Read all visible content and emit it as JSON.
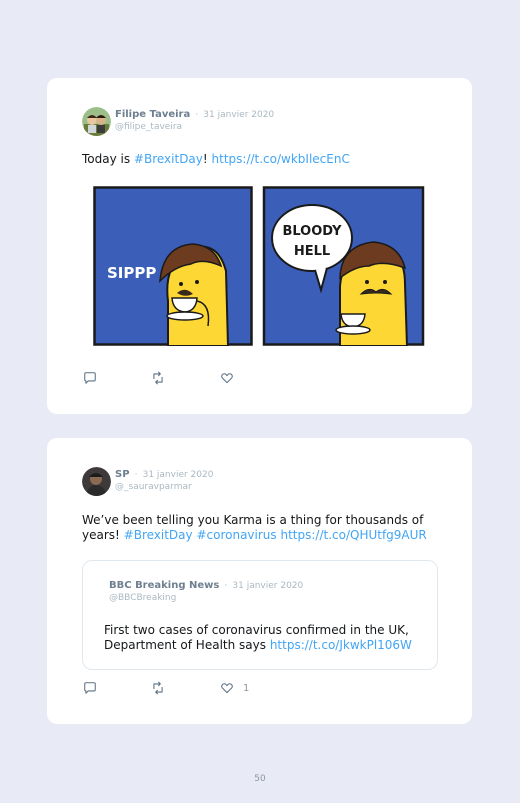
{
  "tweets": [
    {
      "user": {
        "name": "Filipe Taveira",
        "handle": "@filipe_taveira"
      },
      "separator": "·",
      "date": "31 janvier 2020",
      "text_parts": [
        "Today is ",
        "#BrexitDay",
        "! ",
        "https://t.co/wkbIlecEnC"
      ],
      "comic": {
        "left_text": "SIPPP",
        "speech_line1": "BLOODY",
        "speech_line2": "HELL"
      },
      "actions": {
        "reply_icon": "reply-icon",
        "retweet_icon": "retweet-icon",
        "like_icon": "heart-icon"
      }
    },
    {
      "user": {
        "name": "SP",
        "handle": "@_sauravparmar"
      },
      "separator": "·",
      "date": "31 janvier 2020",
      "text_line1": "We’ve been telling you Karma is a thing for thousands of",
      "text_parts": [
        "years! ",
        "#BrexitDay",
        " ",
        "#coronavirus",
        " ",
        "https://t.co/QHUtfg9AUR"
      ],
      "quoted": {
        "user": {
          "name": "BBC Breaking News",
          "handle": "@BBCBreaking"
        },
        "separator": "·",
        "date": "31 janvier 2020",
        "text_line1": "First two cases of coronavirus confirmed in the UK,",
        "text_line2_prefix": "Department of Health says ",
        "link": "https://t.co/JkwkPl106W"
      },
      "actions": {
        "reply_icon": "reply-icon",
        "retweet_icon": "retweet-icon",
        "like_icon": "heart-icon",
        "like_count": "1"
      }
    }
  ],
  "page_number": "50",
  "colors": {
    "background": "#e8eaf6",
    "link": "#42a5f5",
    "comic_blue": "#3b5eb8",
    "comic_yellow": "#fdd835"
  }
}
